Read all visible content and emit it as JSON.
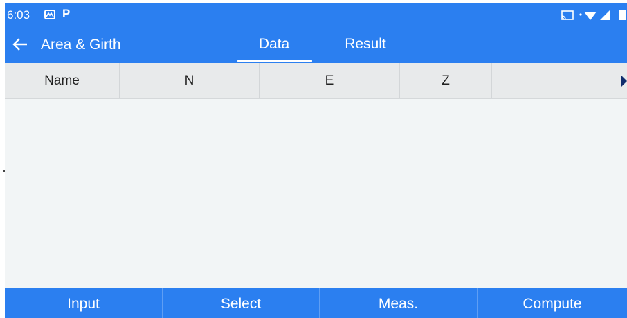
{
  "status_bar": {
    "time": "6:03",
    "icons": [
      "gallery-app-icon",
      "p-app-icon",
      "cast-icon",
      "wifi-icon",
      "signal-icon",
      "battery-icon"
    ],
    "p_glyph": "P"
  },
  "app_bar": {
    "title": "Area & Girth",
    "tabs": [
      {
        "label": "Data",
        "selected": true
      },
      {
        "label": "Result",
        "selected": false
      }
    ]
  },
  "table": {
    "columns": [
      "Name",
      "N",
      "E",
      "Z"
    ],
    "rows": []
  },
  "bottom_bar": {
    "buttons": [
      "Input",
      "Select",
      "Meas.",
      "Compute"
    ]
  },
  "colors": {
    "primary": "#2b7ff0",
    "header_bg": "#e8eaeb",
    "body_bg": "#f2f5f6"
  }
}
